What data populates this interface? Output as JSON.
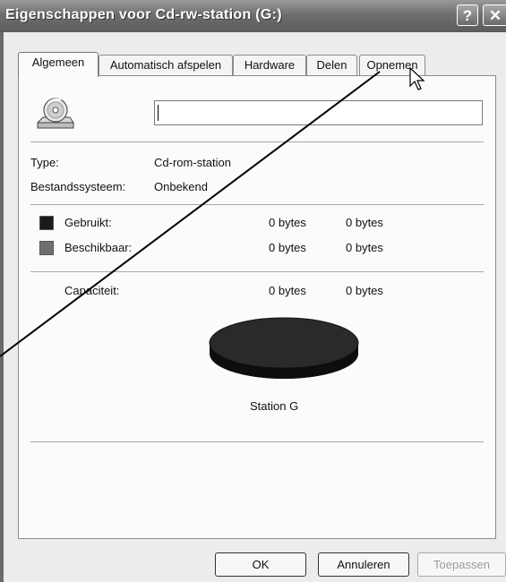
{
  "window": {
    "title": "Eigenschappen voor Cd-rw-station (G:)",
    "help_glyph": "?",
    "close_glyph": "✕"
  },
  "tabs": [
    {
      "label": "Algemeen",
      "active": true
    },
    {
      "label": "Automatisch afspelen"
    },
    {
      "label": "Hardware"
    },
    {
      "label": "Delen"
    },
    {
      "label": "Opnemen"
    }
  ],
  "general": {
    "name_value": "",
    "icon": "cd-drive-icon",
    "type_label": "Type:",
    "type_value": "Cd-rom-station",
    "fs_label": "Bestandssysteem:",
    "fs_value": "Onbekend",
    "used_label": "Gebruikt:",
    "used_bytes": "0 bytes",
    "used_alt": "0 bytes",
    "free_label": "Beschikbaar:",
    "free_bytes": "0 bytes",
    "free_alt": "0 bytes",
    "capacity_label": "Capaciteit:",
    "capacity_bytes": "0 bytes",
    "capacity_alt": "0 bytes",
    "drive_caption": "Station G",
    "used_color": "#1a1a1a",
    "free_color": "#6f6f6f"
  },
  "buttons": {
    "ok": "OK",
    "cancel": "Annuleren",
    "apply": "Toepassen"
  }
}
